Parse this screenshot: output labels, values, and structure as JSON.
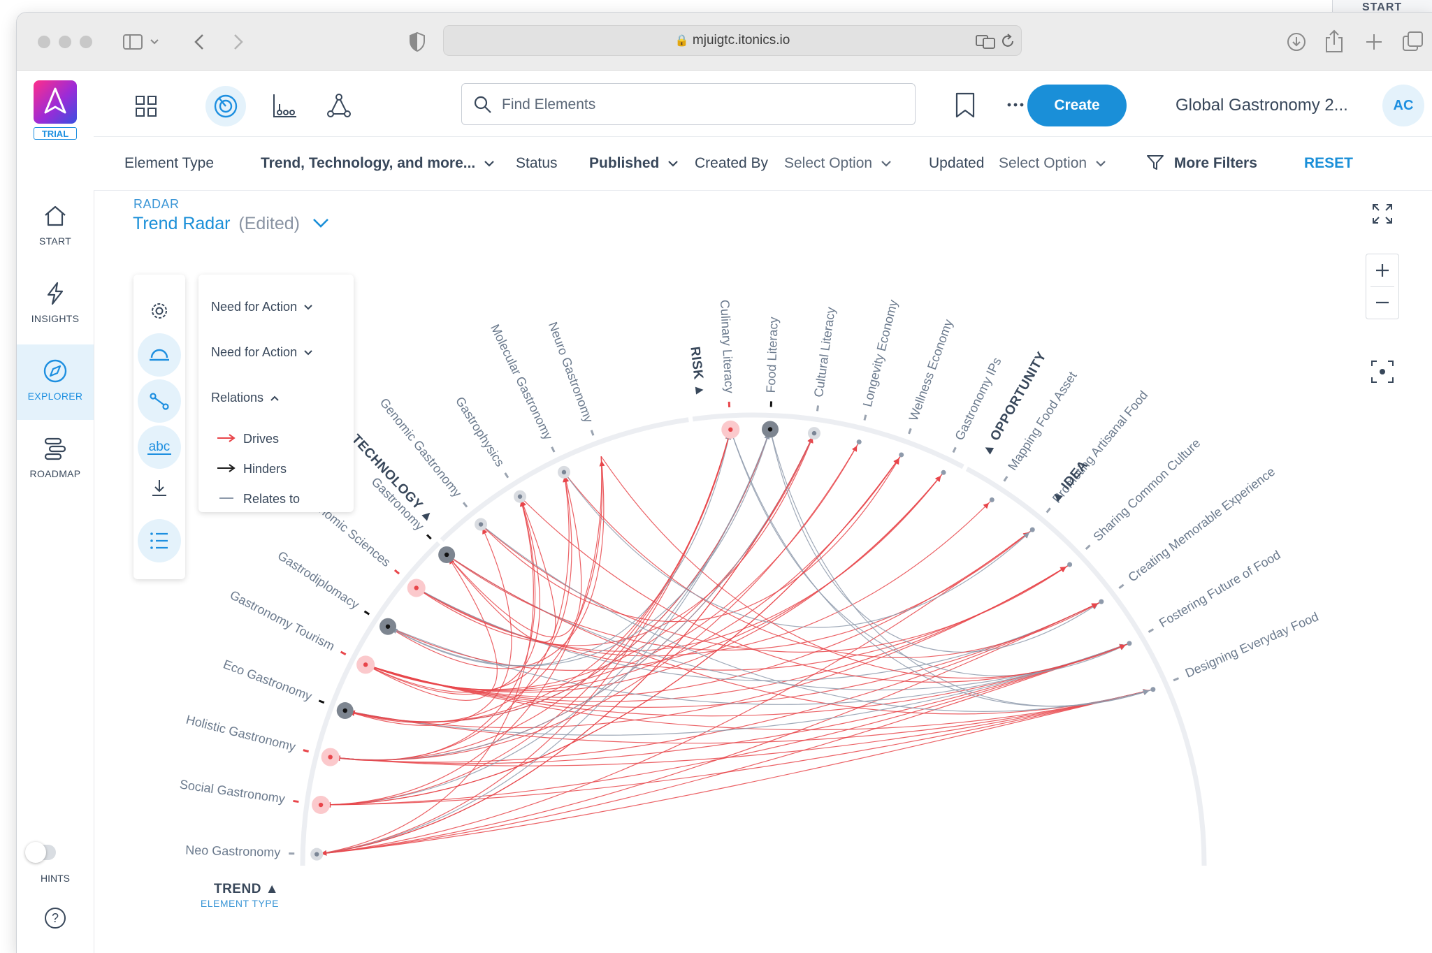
{
  "background_window": {
    "label": "START"
  },
  "browser": {
    "url": "mjuigtc.itonics.io"
  },
  "sidebar": {
    "trial_badge": "TRIAL",
    "items": [
      {
        "label": "START",
        "icon": "home-icon"
      },
      {
        "label": "INSIGHTS",
        "icon": "lightning-icon"
      },
      {
        "label": "EXPLORER",
        "icon": "compass-icon",
        "active": true
      },
      {
        "label": "ROADMAP",
        "icon": "roadmap-icon"
      }
    ],
    "hints_label": "HINTS",
    "hints_on": false
  },
  "toolbar": {
    "search_placeholder": "Find Elements",
    "create_label": "Create",
    "workspace": "Global Gastronomy 2...",
    "avatar_initials": "AC"
  },
  "filters": {
    "element_type_label": "Element Type",
    "element_type_value": "Trend, Technology, and more...",
    "status_label": "Status",
    "status_value": "Published",
    "created_by_label": "Created By",
    "created_by_value": "Select Option",
    "updated_label": "Updated",
    "updated_value": "Select Option",
    "more_filters": "More Filters",
    "reset": "RESET"
  },
  "radar": {
    "kicker": "RADAR",
    "title": "Trend Radar",
    "edited": "(Edited)",
    "legend": {
      "dropdown1": "Need for Action",
      "dropdown2": "Need for Action",
      "relations": "Relations",
      "drives": "Drives",
      "hinders": "Hinders",
      "relates_to": "Relates to"
    },
    "element_type_caption": "ELEMENT TYPE",
    "colors": {
      "drives": "#e8454a",
      "hinders": "#1f1f1f",
      "relates": "#8e9aab",
      "accent": "#1a8fd8"
    },
    "sectors": [
      "TREND",
      "TECHNOLOGY",
      "RISK",
      "OPPORTUNITY",
      "IDEA"
    ],
    "elements": [
      "Neo Gastronomy",
      "Social Gastronomy",
      "Holistic Gastronomy",
      "Eco Gastronomy",
      "Gastronomy Tourism",
      "Gastrodiplomacy",
      "Gastronomic Sciences",
      "Gastronomy",
      "Genomic Gastronomy",
      "Gastrophysics",
      "Molecular Gastronomy",
      "Neuro Gastronomy",
      "Culinary Literacy",
      "Food Literacy",
      "Cultural Literacy",
      "Longevity Economy",
      "Wellness Economy",
      "Gastronomy IPs",
      "Mapping Food Asset",
      "Promoting Artisanal Food",
      "Sharing Common Culture",
      "Creating Memorable Experience",
      "Fostering Future of Food",
      "Designing Everyday Food"
    ]
  }
}
